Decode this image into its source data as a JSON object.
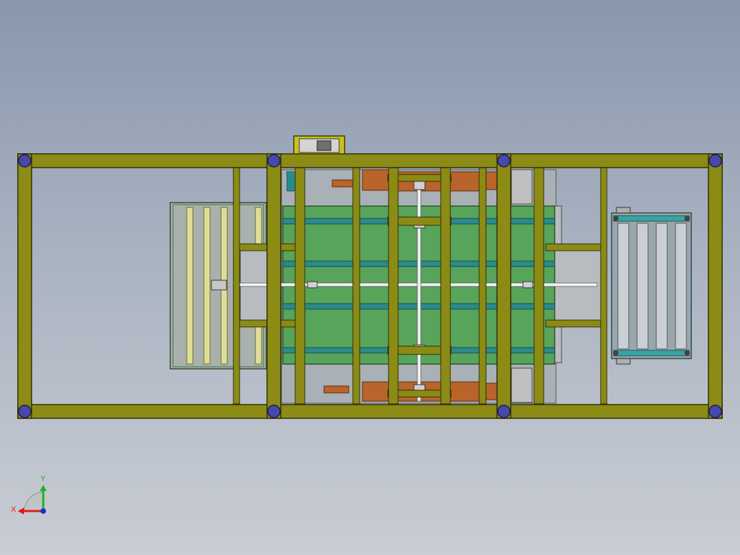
{
  "viewport": {
    "background_top": "#8997ad",
    "background_bottom": "#c9cdd4"
  },
  "colors": {
    "frame": "#8b8b16",
    "frame_edge": "#2e2e05",
    "corner_node": "#4848a8",
    "green_panel": "#58a45a",
    "rail": "#2b8b8b",
    "orange_plate": "#b8642a",
    "roller": "#dede9a",
    "teal_roller": "#39a4a4",
    "grey_part": "#b0b0b0"
  },
  "model": {
    "view": "top",
    "components": [
      "main-frame",
      "left-roller-conveyor",
      "center-platform",
      "right-roller-conveyor",
      "top-motor-box",
      "drive-shaft"
    ]
  },
  "triad": {
    "x_label": "X",
    "y_label": "Y",
    "x_color": "#e01818",
    "y_color": "#18b418",
    "z_color": "#1830d0"
  }
}
